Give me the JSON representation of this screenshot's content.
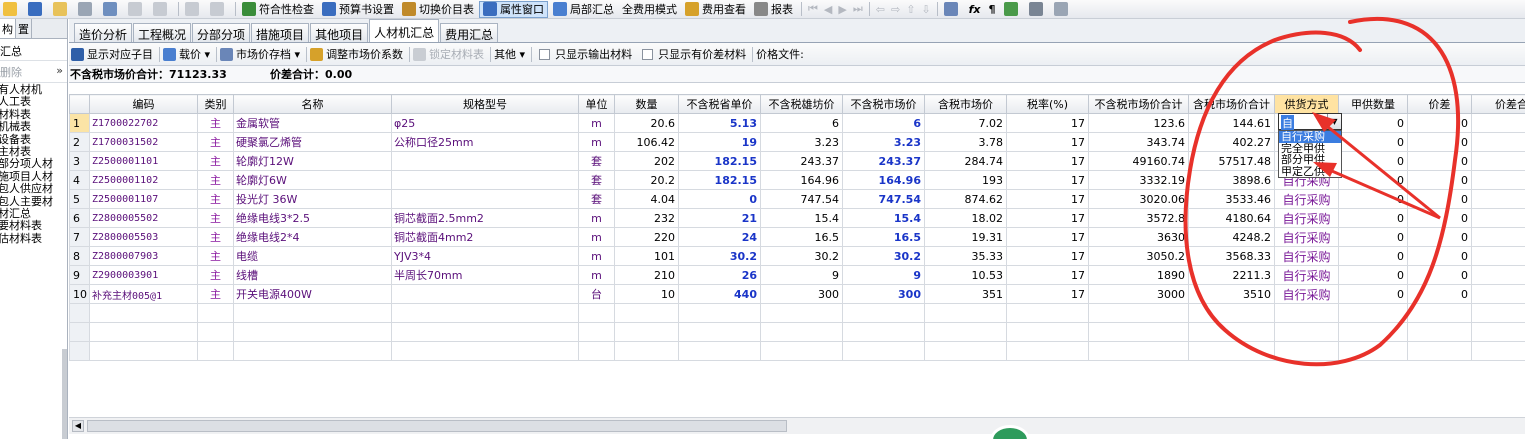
{
  "toolbar": {
    "items": [
      {
        "label": "符合性检查",
        "icon": "check-icon",
        "color": "#3a8d3a"
      },
      {
        "label": "预算书设置",
        "icon": "gear-icon",
        "color": "#3a6dbf"
      },
      {
        "label": "切换价目表",
        "icon": "switch-icon",
        "color": "#c08a2a"
      },
      {
        "label": "属性窗口",
        "icon": "window-icon",
        "color": "#3a6dbf"
      },
      {
        "label": "局部汇总",
        "icon": "summary-icon",
        "color": "#4a7fd0"
      },
      {
        "label": "全费用模式",
        "icon": "",
        "color": ""
      },
      {
        "label": "费用查看",
        "icon": "money-icon",
        "color": "#d6a12a"
      },
      {
        "label": "报表",
        "icon": "report-icon",
        "color": "#888888"
      }
    ]
  },
  "left_panel": {
    "tabs": [
      "构",
      "置"
    ],
    "summary_label": "汇总",
    "delete_label": "删除",
    "more_label": "»",
    "tree": [
      "有人材机",
      "人工表",
      "材料表",
      "机械表",
      "设备表",
      "主材表",
      "部分项人材",
      "施项目人材",
      "包人供应材",
      "包人主要材",
      "材汇总",
      "要材料表",
      "估材料表"
    ]
  },
  "tabs": [
    "造价分析",
    "工程概况",
    "分部分项",
    "措施项目",
    "其他项目",
    "人材机汇总",
    "费用汇总"
  ],
  "active_tab": "人材机汇总",
  "subtoolbar": {
    "show_sub": "显示对应子目",
    "load_price": "载价",
    "market_save": "市场价存档",
    "adjust_coef": "调整市场价系数",
    "lock_material": "锁定材料表",
    "other": "其他",
    "only_output": "只显示输出材料",
    "only_diff": "只显示有价差材料",
    "price_file": "价格文件:"
  },
  "totals": {
    "market_total": "不含税市场价合计：71123.33",
    "diff_total": "价差合计：0.00"
  },
  "grid": {
    "headers": [
      "",
      "编码",
      "类别",
      "名称",
      "规格型号",
      "单位",
      "数量",
      "不含税省单价",
      "不含税雄坊价",
      "不含税市场价",
      "含税市场价",
      "税率(%)",
      "不含税市场价合计",
      "含税市场价合计",
      "供货方式",
      "甲供数量",
      "价差",
      "价差合"
    ],
    "rows": [
      {
        "no": "1",
        "code": "Z1700022702",
        "cat": "主",
        "name": "金属软管",
        "spec": "φ25",
        "unit": "m",
        "qty": "20.6",
        "prov": "5.13",
        "xf": "6",
        "mkt": "6",
        "taxmkt": "7.02",
        "rate": "17",
        "mtotal": "123.6",
        "taxtotal": "144.61",
        "supply": "",
        "jia": "0",
        "diff": "0"
      },
      {
        "no": "2",
        "code": "Z1700031502",
        "cat": "主",
        "name": "硬聚氯乙烯管",
        "spec": "公称口径25mm",
        "unit": "m",
        "qty": "106.42",
        "prov": "19",
        "xf": "3.23",
        "mkt": "3.23",
        "taxmkt": "3.78",
        "rate": "17",
        "mtotal": "343.74",
        "taxtotal": "402.27",
        "supply": "",
        "jia": "0",
        "diff": "0"
      },
      {
        "no": "3",
        "code": "Z2500001101",
        "cat": "主",
        "name": "轮廓灯12W",
        "spec": "",
        "unit": "套",
        "qty": "202",
        "prov": "182.15",
        "xf": "243.37",
        "mkt": "243.37",
        "taxmkt": "284.74",
        "rate": "17",
        "mtotal": "49160.74",
        "taxtotal": "57517.48",
        "supply": "",
        "jia": "0",
        "diff": "0"
      },
      {
        "no": "4",
        "code": "Z2500001102",
        "cat": "主",
        "name": "轮廓灯6W",
        "spec": "",
        "unit": "套",
        "qty": "20.2",
        "prov": "182.15",
        "xf": "164.96",
        "mkt": "164.96",
        "taxmkt": "193",
        "rate": "17",
        "mtotal": "3332.19",
        "taxtotal": "3898.6",
        "supply": "自行采购",
        "jia": "0",
        "diff": "0"
      },
      {
        "no": "5",
        "code": "Z2500001107",
        "cat": "主",
        "name": "投光灯 36W",
        "spec": "",
        "unit": "套",
        "qty": "4.04",
        "prov": "0",
        "xf": "747.54",
        "mkt": "747.54",
        "taxmkt": "874.62",
        "rate": "17",
        "mtotal": "3020.06",
        "taxtotal": "3533.46",
        "supply": "自行采购",
        "jia": "0",
        "diff": "0"
      },
      {
        "no": "6",
        "code": "Z2800005502",
        "cat": "主",
        "name": "绝缘电线3*2.5",
        "spec": "铜芯截面2.5mm2",
        "unit": "m",
        "qty": "232",
        "prov": "21",
        "xf": "15.4",
        "mkt": "15.4",
        "taxmkt": "18.02",
        "rate": "17",
        "mtotal": "3572.8",
        "taxtotal": "4180.64",
        "supply": "自行采购",
        "jia": "0",
        "diff": "0"
      },
      {
        "no": "7",
        "code": "Z2800005503",
        "cat": "主",
        "name": "绝缘电线2*4",
        "spec": "铜芯截面4mm2",
        "unit": "m",
        "qty": "220",
        "prov": "24",
        "xf": "16.5",
        "mkt": "16.5",
        "taxmkt": "19.31",
        "rate": "17",
        "mtotal": "3630",
        "taxtotal": "4248.2",
        "supply": "自行采购",
        "jia": "0",
        "diff": "0"
      },
      {
        "no": "8",
        "code": "Z2800007903",
        "cat": "主",
        "name": "电缆",
        "spec": "YJV3*4",
        "unit": "m",
        "qty": "101",
        "prov": "30.2",
        "xf": "30.2",
        "mkt": "30.2",
        "taxmkt": "35.33",
        "rate": "17",
        "mtotal": "3050.2",
        "taxtotal": "3568.33",
        "supply": "自行采购",
        "jia": "0",
        "diff": "0"
      },
      {
        "no": "9",
        "code": "Z2900003901",
        "cat": "主",
        "name": "线槽",
        "spec": "半周长70mm",
        "unit": "m",
        "qty": "210",
        "prov": "26",
        "xf": "9",
        "mkt": "9",
        "taxmkt": "10.53",
        "rate": "17",
        "mtotal": "1890",
        "taxtotal": "2211.3",
        "supply": "自行采购",
        "jia": "0",
        "diff": "0"
      },
      {
        "no": "10",
        "code": "补充主材005@1",
        "cat": "主",
        "name": "开关电源400W",
        "spec": "",
        "unit": "台",
        "qty": "10",
        "prov": "440",
        "xf": "300",
        "mkt": "300",
        "taxmkt": "351",
        "rate": "17",
        "mtotal": "3000",
        "taxtotal": "3510",
        "supply": "自行采购",
        "jia": "0",
        "diff": "0"
      }
    ]
  },
  "combo": {
    "value": "自",
    "arrow": "▼"
  },
  "dropdown": {
    "options": [
      "自行采购",
      "完全甲供",
      "部分甲供",
      "甲定乙供"
    ],
    "highlighted": 0
  },
  "colors": {
    "annotation": "#e8312a",
    "selection": "#3b7de0"
  }
}
